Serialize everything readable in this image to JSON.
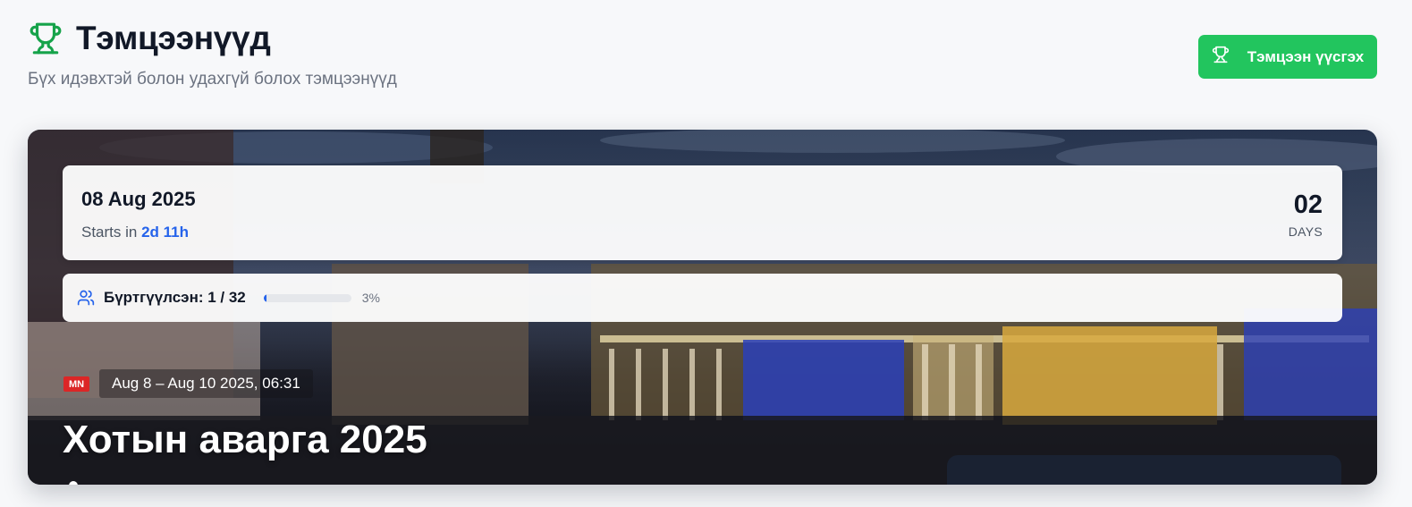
{
  "header": {
    "title": "Тэмцээнүүд",
    "subtitle": "Бүх идэвхтэй болон удахгүй болох тэмцээнүүд",
    "create_button_label": "Тэмцээн үүсгэх",
    "title_icon": "trophy-icon",
    "accent_color": "#22c55e"
  },
  "featured": {
    "date": "08 Aug 2025",
    "starts_prefix": "Starts in",
    "starts_value": "2d 11h",
    "countdown_value": "02",
    "countdown_unit": "DAYS",
    "registered_label": "Бүртгүүлсэн: 1 / 32",
    "registered_count": 1,
    "registered_capacity": 32,
    "progress_percent_label": "3%",
    "progress_fraction": 0.03,
    "country_code": "MN",
    "date_range": "Aug 8 – Aug 10 2025, 06:31",
    "title": "Хотын аварга 2025"
  }
}
